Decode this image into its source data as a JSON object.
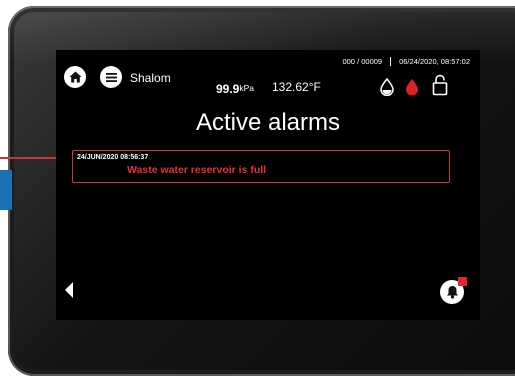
{
  "status": {
    "counter": "000 / 00009",
    "datetime": "06/24/2020, 08:57:02"
  },
  "header": {
    "user": "Shalom",
    "pressure_value": "99.9",
    "pressure_unit": "kPa",
    "temperature": "132.62°F"
  },
  "icons": {
    "home": "home-icon",
    "menu": "menu-icon",
    "clean_water": "clean-water-drop-icon",
    "waste_water": "waste-water-drop-icon",
    "lock": "lock-icon",
    "back": "back-arrow-icon",
    "alarm_bell": "alarm-bell-icon"
  },
  "colors": {
    "alarm_border": "#d2353e",
    "alarm_text": "#e0333d",
    "waste_drop": "#d8222c",
    "clean_drop": "#ffffff",
    "bell_badge": "#e2262f"
  },
  "page": {
    "title": "Active alarms"
  },
  "alarms": [
    {
      "timestamp": "24/JUN/2020 08:56:37",
      "message": "Waste water reservoir is full"
    }
  ]
}
